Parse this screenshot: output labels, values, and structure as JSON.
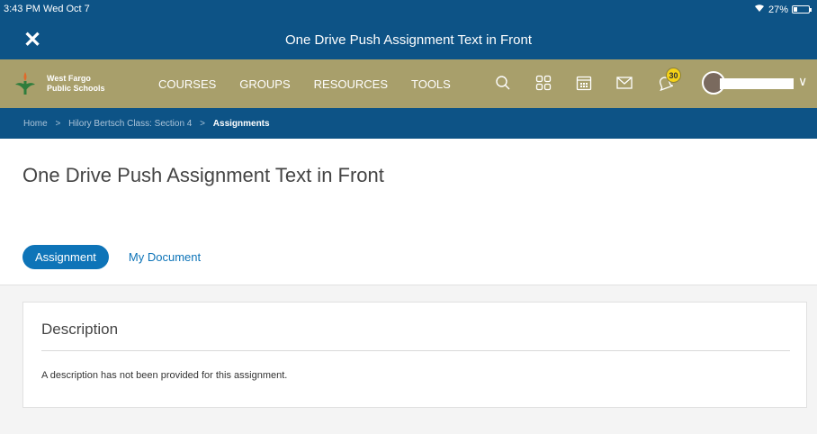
{
  "statusbar": {
    "time": "3:43 PM  Wed Oct 7",
    "battery": "27%",
    "battery_level": 0.27
  },
  "titlebar": {
    "close": "✕",
    "title": "One Drive Push Assignment Text in Front"
  },
  "brand": {
    "line1": "West Fargo",
    "line2": "Public Schools"
  },
  "nav": {
    "menu": [
      "COURSES",
      "GROUPS",
      "RESOURCES",
      "TOOLS"
    ],
    "notification_count": "30",
    "chevron": "∨"
  },
  "breadcrumb": {
    "items": [
      "Home",
      "Hilory Bertsch Class: Section 4",
      "Assignments"
    ],
    "separator": ">"
  },
  "page": {
    "title": "One Drive Push Assignment Text in Front"
  },
  "tabs": {
    "active": "Assignment",
    "other": "My Document"
  },
  "description": {
    "heading": "Description",
    "text": "A description has not been provided for this assignment."
  },
  "colors": {
    "header_blue": "#0d5386",
    "nav_gold": "#a89f6b",
    "accent": "#0e74b8",
    "badge": "#f5d218"
  }
}
